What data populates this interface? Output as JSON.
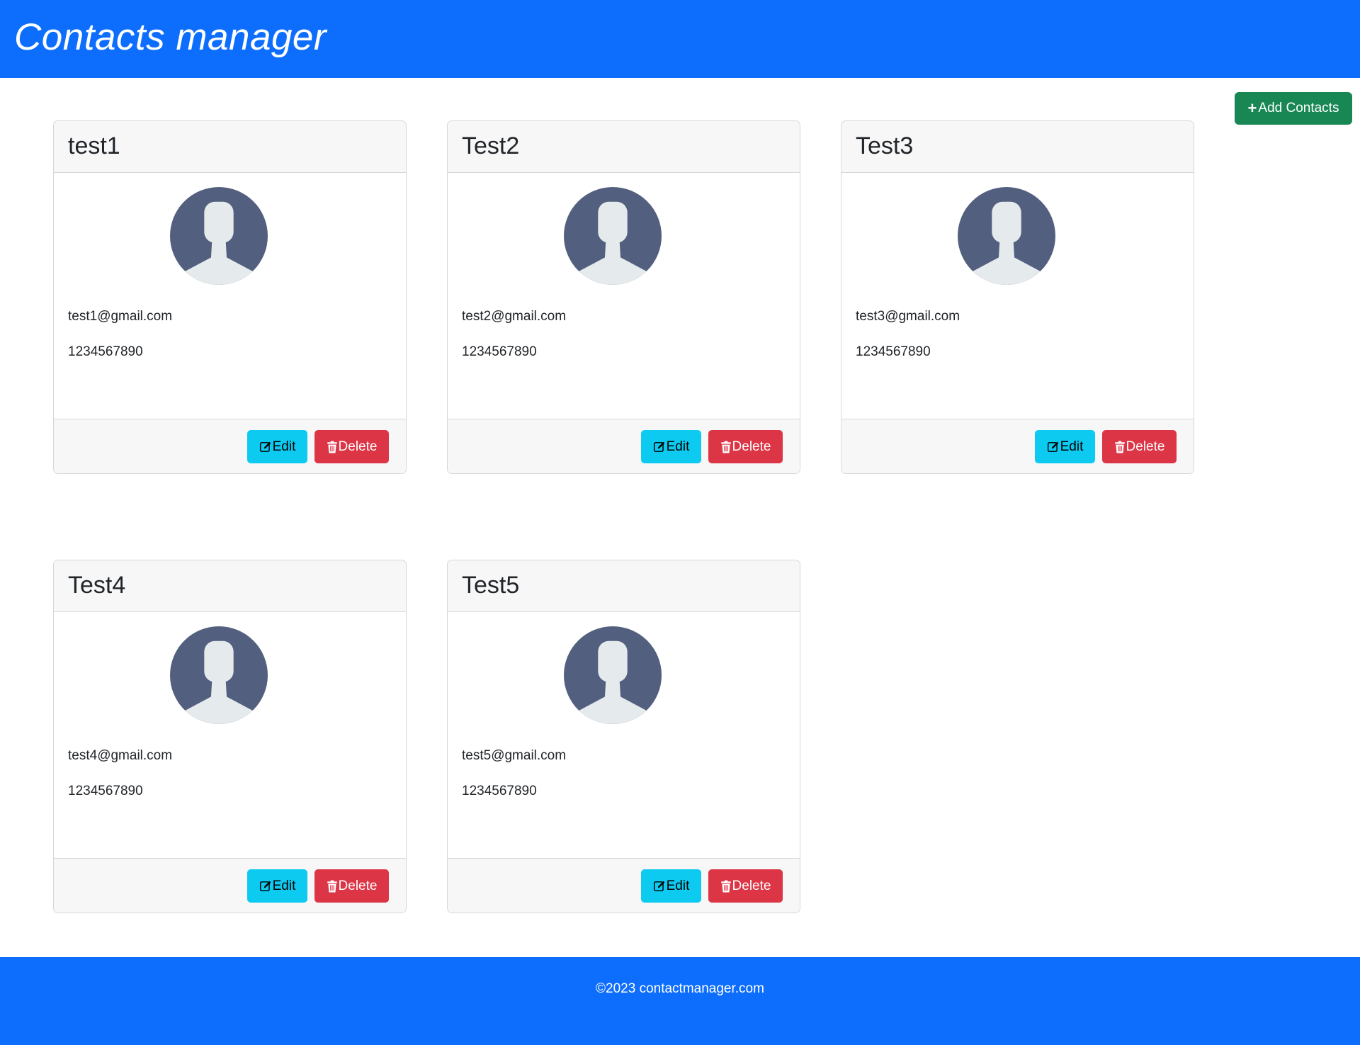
{
  "header": {
    "title": "Contacts manager"
  },
  "actions": {
    "add_label": "Add Contacts",
    "add_icon": "plus-icon"
  },
  "contacts": [
    {
      "name": "test1",
      "email": "test1@gmail.com",
      "phone": "1234567890"
    },
    {
      "name": "Test2",
      "email": "test2@gmail.com",
      "phone": "1234567890"
    },
    {
      "name": "Test3",
      "email": "test3@gmail.com",
      "phone": "1234567890"
    },
    {
      "name": "Test4",
      "email": "test4@gmail.com",
      "phone": "1234567890"
    },
    {
      "name": "Test5",
      "email": "test5@gmail.com",
      "phone": "1234567890"
    }
  ],
  "card_actions": {
    "edit_label": "Edit",
    "edit_icon": "edit-icon",
    "delete_label": "Delete",
    "delete_icon": "trash-icon"
  },
  "footer": {
    "copyright": "©2023 contactmanager.com"
  },
  "colors": {
    "primary": "#0d6efd",
    "success": "#198754",
    "info": "#0dcaf0",
    "danger": "#dc3545",
    "avatar_bg": "#535f7f",
    "avatar_figure": "#e5eaec"
  }
}
